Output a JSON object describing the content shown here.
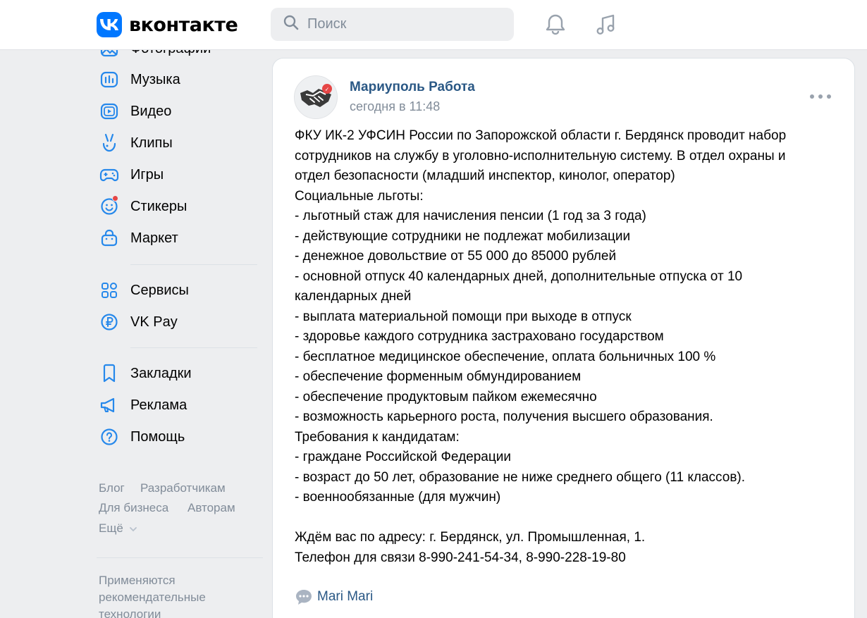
{
  "header": {
    "logo_text": "вконтакте",
    "search_placeholder": "Поиск"
  },
  "sidebar": {
    "items": [
      {
        "label": "Фотографии",
        "icon": "photo-icon"
      },
      {
        "label": "Музыка",
        "icon": "music-icon"
      },
      {
        "label": "Видео",
        "icon": "video-icon"
      },
      {
        "label": "Клипы",
        "icon": "clips-icon"
      },
      {
        "label": "Игры",
        "icon": "gamepad-icon"
      },
      {
        "label": "Стикеры",
        "icon": "sticker-icon"
      },
      {
        "label": "Маркет",
        "icon": "market-icon"
      },
      {
        "label": "Сервисы",
        "icon": "services-icon"
      },
      {
        "label": "VK Pay",
        "icon": "vkpay-icon"
      },
      {
        "label": "Закладки",
        "icon": "bookmark-icon"
      },
      {
        "label": "Реклама",
        "icon": "megaphone-icon"
      },
      {
        "label": "Помощь",
        "icon": "help-icon"
      }
    ],
    "footer_links": [
      "Блог",
      "Разработчикам",
      "Для бизнеса",
      "Авторам",
      "Ещё"
    ],
    "footer_note": "Применяются рекомендательные технологии"
  },
  "post": {
    "author": "Мариуполь Работа",
    "time": "сегодня в 11:48",
    "text": "ФКУ ИК-2 УФСИН России по Запорожской области г. Бердянск проводит набор\nсотрудников на службу в уголовно-исполнительную систему. В отдел охраны и\nотдел безопасности (младший инспектор, кинолог, оператор)\nСоциальные льготы:\n- льготный стаж для начисления пенсии (1 год за 3 года)\n- действующие сотрудники не подлежат мобилизации\n- денежное довольствие от 55 000 до 85000 рублей\n- основной отпуск 40 календарных дней, дополнительные отпуска от 10\nкалендарных дней\n- выплата материальной помощи при выходе в отпуск\n- здоровье каждого сотрудника застраховано государством\n- бесплатное медицинское обеспечение, оплата больничных 100 %\n- обеспечение форменным обмундированием\n- обеспечение продуктовым пайком ежемесячно\n- возможность карьерного роста, получения высшего образования.\nТребования к кандидатам:\n- граждане Российской Федерации\n- возраст до 50 лет, образование не ниже среднего общего (11 классов).\n- военнообязанные (для мужчин)\n\nЖдём вас по адресу: г. Бердянск, ул. Промышленная, 1.\nТелефон для связи 8-990-241-54-34, 8-990-228-19-80",
    "signature": "Mari Mari"
  },
  "colors": {
    "accent": "#0077ff",
    "link": "#2a5885",
    "muted": "#818c99",
    "icon": "#2688eb",
    "badge": "#e64646"
  }
}
